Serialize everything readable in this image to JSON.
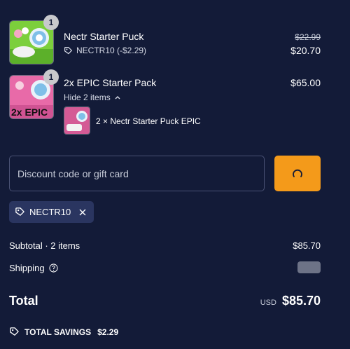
{
  "items": [
    {
      "title": "Nectr Starter Puck",
      "quantity": "1",
      "discount_label": "NECTR10 (-$2.29)",
      "original_price": "$22.99",
      "price": "$20.70",
      "thumb_color": "#7ccf3c"
    },
    {
      "title": "2x EPIC Starter Pack",
      "quantity": "1",
      "price": "$65.00",
      "toggle_label": "Hide 2 items",
      "thumb_color": "#e86aa8",
      "thumb_text": "2x EPIC",
      "sub_item": {
        "label": "2 × Nectr Starter Puck EPIC",
        "thumb_color": "#d45a95"
      }
    }
  ],
  "discount": {
    "placeholder": "Discount code or gift card",
    "applied_code": "NECTR10"
  },
  "summary": {
    "subtotal_label": "Subtotal · 2 items",
    "subtotal_value": "$85.70",
    "shipping_label": "Shipping",
    "total_label": "Total",
    "currency": "USD",
    "total_value": "$85.70",
    "savings_label": "TOTAL SAVINGS",
    "savings_value": "$2.29"
  },
  "colors": {
    "background": "#131b38",
    "accent": "#f49a1a",
    "chip": "#2a3560"
  }
}
